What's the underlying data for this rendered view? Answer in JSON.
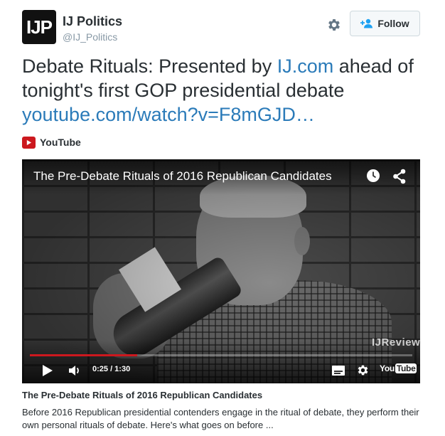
{
  "account": {
    "avatar_text": "IJP",
    "name": "IJ Politics",
    "handle": "@IJ_Politics",
    "follow_label": "Follow"
  },
  "tweet": {
    "text_1": "Debate Rituals: Presented by ",
    "link_1": "IJ.com",
    "text_2": " ahead of tonight's first GOP presidential debate ",
    "link_2": "youtube.com/watch?v=F8mGJD…"
  },
  "card": {
    "source_label": "YouTube",
    "video_title": "The Pre-Debate Rituals of 2016 Republican Candidates",
    "watermark": "IJReview",
    "time": "0:25 / 1:30",
    "progress": 0.28,
    "player_logo_you": "You",
    "player_logo_tube": "Tube",
    "title": "The Pre-Debate Rituals of 2016 Republican Candidates",
    "description": "Before 2016 Republican presidential contenders engage in the ritual of debate, they perform their own personal rituals of debate. Here's what goes on before ..."
  },
  "icons": {
    "settings": "gear-icon",
    "follow": "add-user-icon",
    "source": "youtube-icon",
    "watch_later": "clock-icon",
    "share": "share-icon",
    "play": "play-icon",
    "volume": "volume-icon",
    "captions": "captions-icon",
    "player_settings": "gear-icon"
  },
  "colors": {
    "link": "#2b7bb9",
    "youtube_red": "#cc181e",
    "muted": "#8899a6"
  }
}
